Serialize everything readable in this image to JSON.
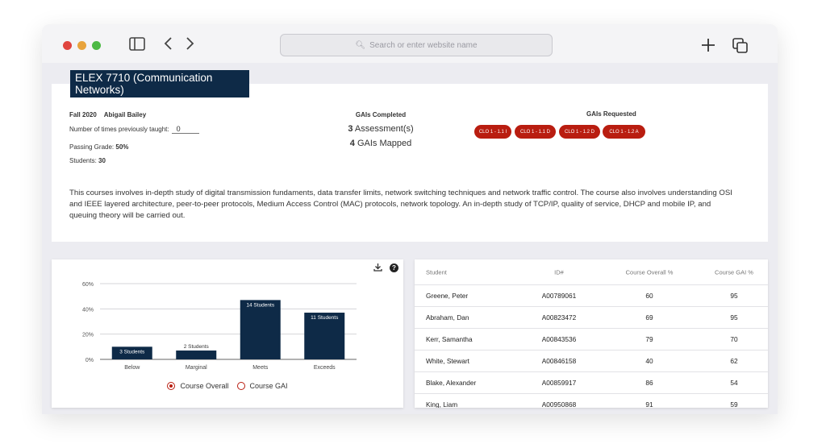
{
  "toolbar": {
    "search_placeholder": "Search or enter website name",
    "colors": {
      "close": "#e0443e",
      "minimize": "#e8a33c",
      "zoom": "#4cb944"
    }
  },
  "course": {
    "title": "ELEX 7710 (Communication Networks)",
    "term": "Fall 2020",
    "instructor": "Abigail Bailey",
    "times_taught_label": "Number of times previously taught:",
    "times_taught_value": "0",
    "passing_label": "Passing Grade:",
    "passing_value": "50%",
    "students_label": "Students:",
    "students_value": "30",
    "description": "This courses involves in-depth study of digital transmission fundaments, data transfer limits, network switching techniques and network traffic control. The course also involves understanding OSI and IEEE layered architecture, peer-to-peer protocols, Medium Access Control (MAC) protocols, network topology. An in-depth study of TCP/IP, quality of service, DHCP and mobile IP, and queuing theory will be carried out."
  },
  "gais_completed": {
    "header": "GAIs Completed",
    "assessments_count": "3",
    "assessments_label": "Assessment(s)",
    "mapped_count": "4",
    "mapped_label": "GAIs Mapped"
  },
  "gais_requested": {
    "header": "GAIs Requested",
    "chips": [
      "CLO 1 - 1.1 I",
      "CLO 1 - 1.1 D",
      "CLO 1 - 1.2 D",
      "CLO 1 - 1.2 A"
    ],
    "chip_color": "#b91d10"
  },
  "chart_data": {
    "type": "bar",
    "categories": [
      "Below",
      "Marginal",
      "Meets",
      "Exceeds"
    ],
    "values": [
      10,
      7,
      47,
      37
    ],
    "data_labels": [
      "3 Students",
      "2 Students",
      "14 Students",
      "11 Students"
    ],
    "yticks": [
      "0%",
      "20%",
      "40%",
      "60%"
    ],
    "ylim": [
      0,
      60
    ],
    "grid": true,
    "bar_color": "#0e2a47",
    "legend": [
      {
        "label": "Course Overall",
        "selected": true
      },
      {
        "label": "Course GAI",
        "selected": false
      }
    ]
  },
  "table": {
    "headers": [
      "Student",
      "ID#",
      "Course Overall %",
      "Course GAI %"
    ],
    "rows": [
      [
        "Greene, Peter",
        "A00789061",
        "60",
        "95"
      ],
      [
        "Abraham, Dan",
        "A00823472",
        "69",
        "95"
      ],
      [
        "Kerr, Samantha",
        "A00843536",
        "79",
        "70"
      ],
      [
        "White, Stewart",
        "A00846158",
        "40",
        "62"
      ],
      [
        "Blake, Alexander",
        "A00859917",
        "86",
        "54"
      ],
      [
        "King, Liam",
        "A00950868",
        "91",
        "59"
      ]
    ]
  }
}
